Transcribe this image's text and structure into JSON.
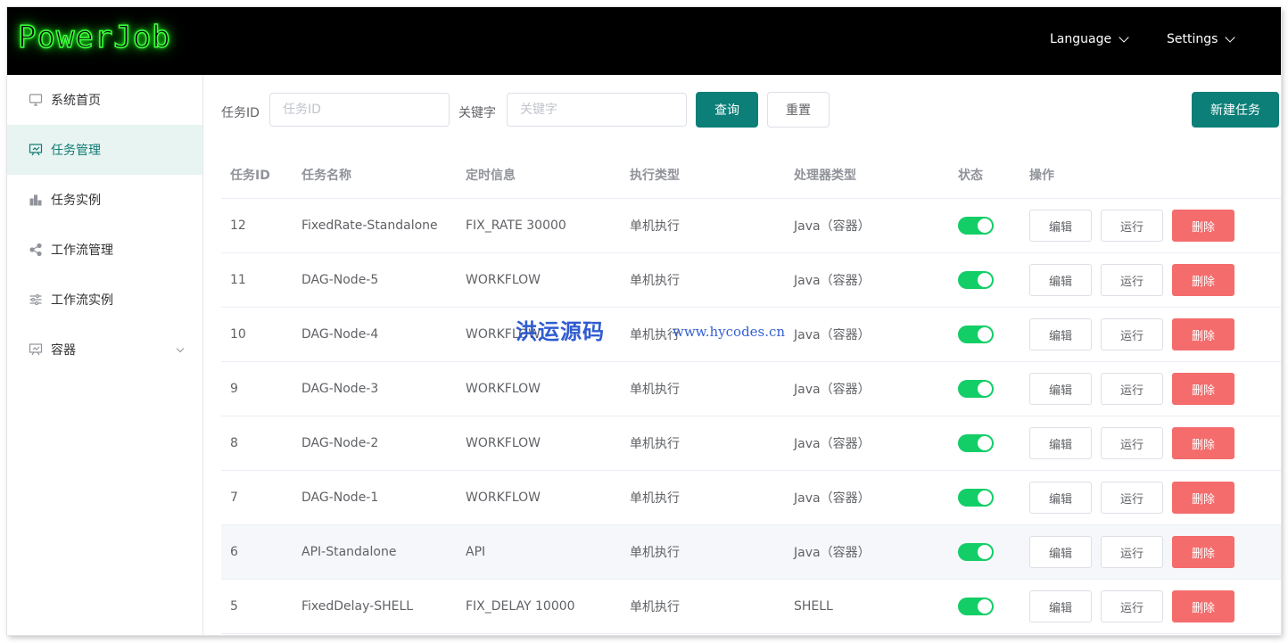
{
  "header": {
    "logo": "PowerJob",
    "language_label": "Language",
    "settings_label": "Settings"
  },
  "sidebar": {
    "items": [
      {
        "label": "系统首页",
        "icon": "monitor-icon"
      },
      {
        "label": "任务管理",
        "icon": "presentation-board-icon",
        "active": true
      },
      {
        "label": "任务实例",
        "icon": "bar-chart-icon"
      },
      {
        "label": "工作流管理",
        "icon": "share-icon"
      },
      {
        "label": "工作流实例",
        "icon": "sliders-icon"
      },
      {
        "label": "容器",
        "icon": "presentation-board-icon",
        "expandable": true
      }
    ]
  },
  "search": {
    "job_id_label": "任务ID",
    "job_id_placeholder": "任务ID",
    "job_id_value": "",
    "keyword_label": "关键字",
    "keyword_placeholder": "关键字",
    "keyword_value": "",
    "query_button": "查询",
    "reset_button": "重置",
    "new_job_button": "新建任务"
  },
  "table": {
    "headers": [
      "任务ID",
      "任务名称",
      "定时信息",
      "执行类型",
      "处理器类型",
      "状态",
      "操作"
    ],
    "action_labels": {
      "edit": "编辑",
      "run": "运行",
      "delete": "删除"
    },
    "rows": [
      {
        "id": "12",
        "name": "FixedRate-Standalone",
        "schedule": "FIX_RATE 30000",
        "exec_type": "单机执行",
        "processor": "Java（容器）",
        "enabled": true
      },
      {
        "id": "11",
        "name": "DAG-Node-5",
        "schedule": "WORKFLOW",
        "exec_type": "单机执行",
        "processor": "Java（容器）",
        "enabled": true
      },
      {
        "id": "10",
        "name": "DAG-Node-4",
        "schedule": "WORKFLOW",
        "exec_type": "单机执行",
        "processor": "Java（容器）",
        "enabled": true
      },
      {
        "id": "9",
        "name": "DAG-Node-3",
        "schedule": "WORKFLOW",
        "exec_type": "单机执行",
        "processor": "Java（容器）",
        "enabled": true
      },
      {
        "id": "8",
        "name": "DAG-Node-2",
        "schedule": "WORKFLOW",
        "exec_type": "单机执行",
        "processor": "Java（容器）",
        "enabled": true
      },
      {
        "id": "7",
        "name": "DAG-Node-1",
        "schedule": "WORKFLOW",
        "exec_type": "单机执行",
        "processor": "Java（容器）",
        "enabled": true
      },
      {
        "id": "6",
        "name": "API-Standalone",
        "schedule": "API",
        "exec_type": "单机执行",
        "processor": "Java（容器）",
        "enabled": true
      },
      {
        "id": "5",
        "name": "FixedDelay-SHELL",
        "schedule": "FIX_DELAY 10000",
        "exec_type": "单机执行",
        "processor": "SHELL",
        "enabled": true
      }
    ]
  },
  "watermark": {
    "text": "洪运源码",
    "url": "www.hycodes.cn"
  },
  "colors": {
    "primary": "#0b7f78",
    "danger": "#f56c6c",
    "switch_on": "#13ce66",
    "header_bg": "#000000",
    "logo_glow": "#3cff3c"
  }
}
